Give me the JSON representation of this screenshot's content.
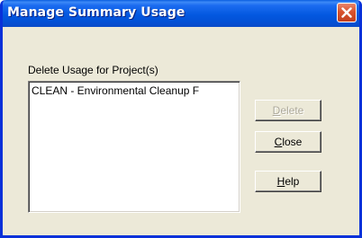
{
  "window": {
    "title": "Manage Summary Usage"
  },
  "dialog": {
    "label": "Delete Usage for Project(s)",
    "list_items": [
      "CLEAN - Environmental Cleanup F"
    ],
    "buttons": {
      "delete": {
        "mnemonic": "D",
        "rest": "elete",
        "enabled": false
      },
      "close": {
        "mnemonic": "C",
        "rest": "lose",
        "enabled": true
      },
      "help": {
        "mnemonic": "H",
        "rest": "elp",
        "enabled": true
      }
    }
  },
  "colors": {
    "titlebar_blue": "#0358e0",
    "face": "#ece9d8",
    "close_red": "#d8532e",
    "disabled_text": "#aca899"
  },
  "icons": {
    "close": "close-x-icon"
  }
}
